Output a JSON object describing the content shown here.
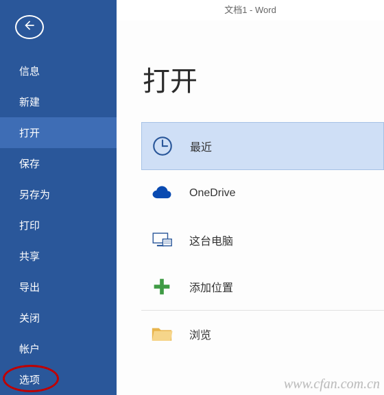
{
  "titlebar": {
    "title": "文档1 - Word"
  },
  "sidebar": {
    "items": [
      {
        "label": "信息"
      },
      {
        "label": "新建"
      },
      {
        "label": "打开",
        "active": true
      },
      {
        "label": "保存"
      },
      {
        "label": "另存为"
      },
      {
        "label": "打印"
      },
      {
        "label": "共享"
      },
      {
        "label": "导出"
      },
      {
        "label": "关闭"
      }
    ],
    "footer_items": [
      {
        "label": "帐户"
      },
      {
        "label": "选项"
      }
    ]
  },
  "main": {
    "heading": "打开",
    "places": [
      {
        "label": "最近",
        "icon": "clock-icon",
        "selected": true
      },
      {
        "label": "OneDrive",
        "icon": "cloud-icon"
      },
      {
        "label": "这台电脑",
        "icon": "computer-icon"
      },
      {
        "label": "添加位置",
        "icon": "plus-icon"
      }
    ],
    "browse": {
      "label": "浏览",
      "icon": "folder-icon"
    }
  },
  "watermark": "www.cfan.com.cn"
}
